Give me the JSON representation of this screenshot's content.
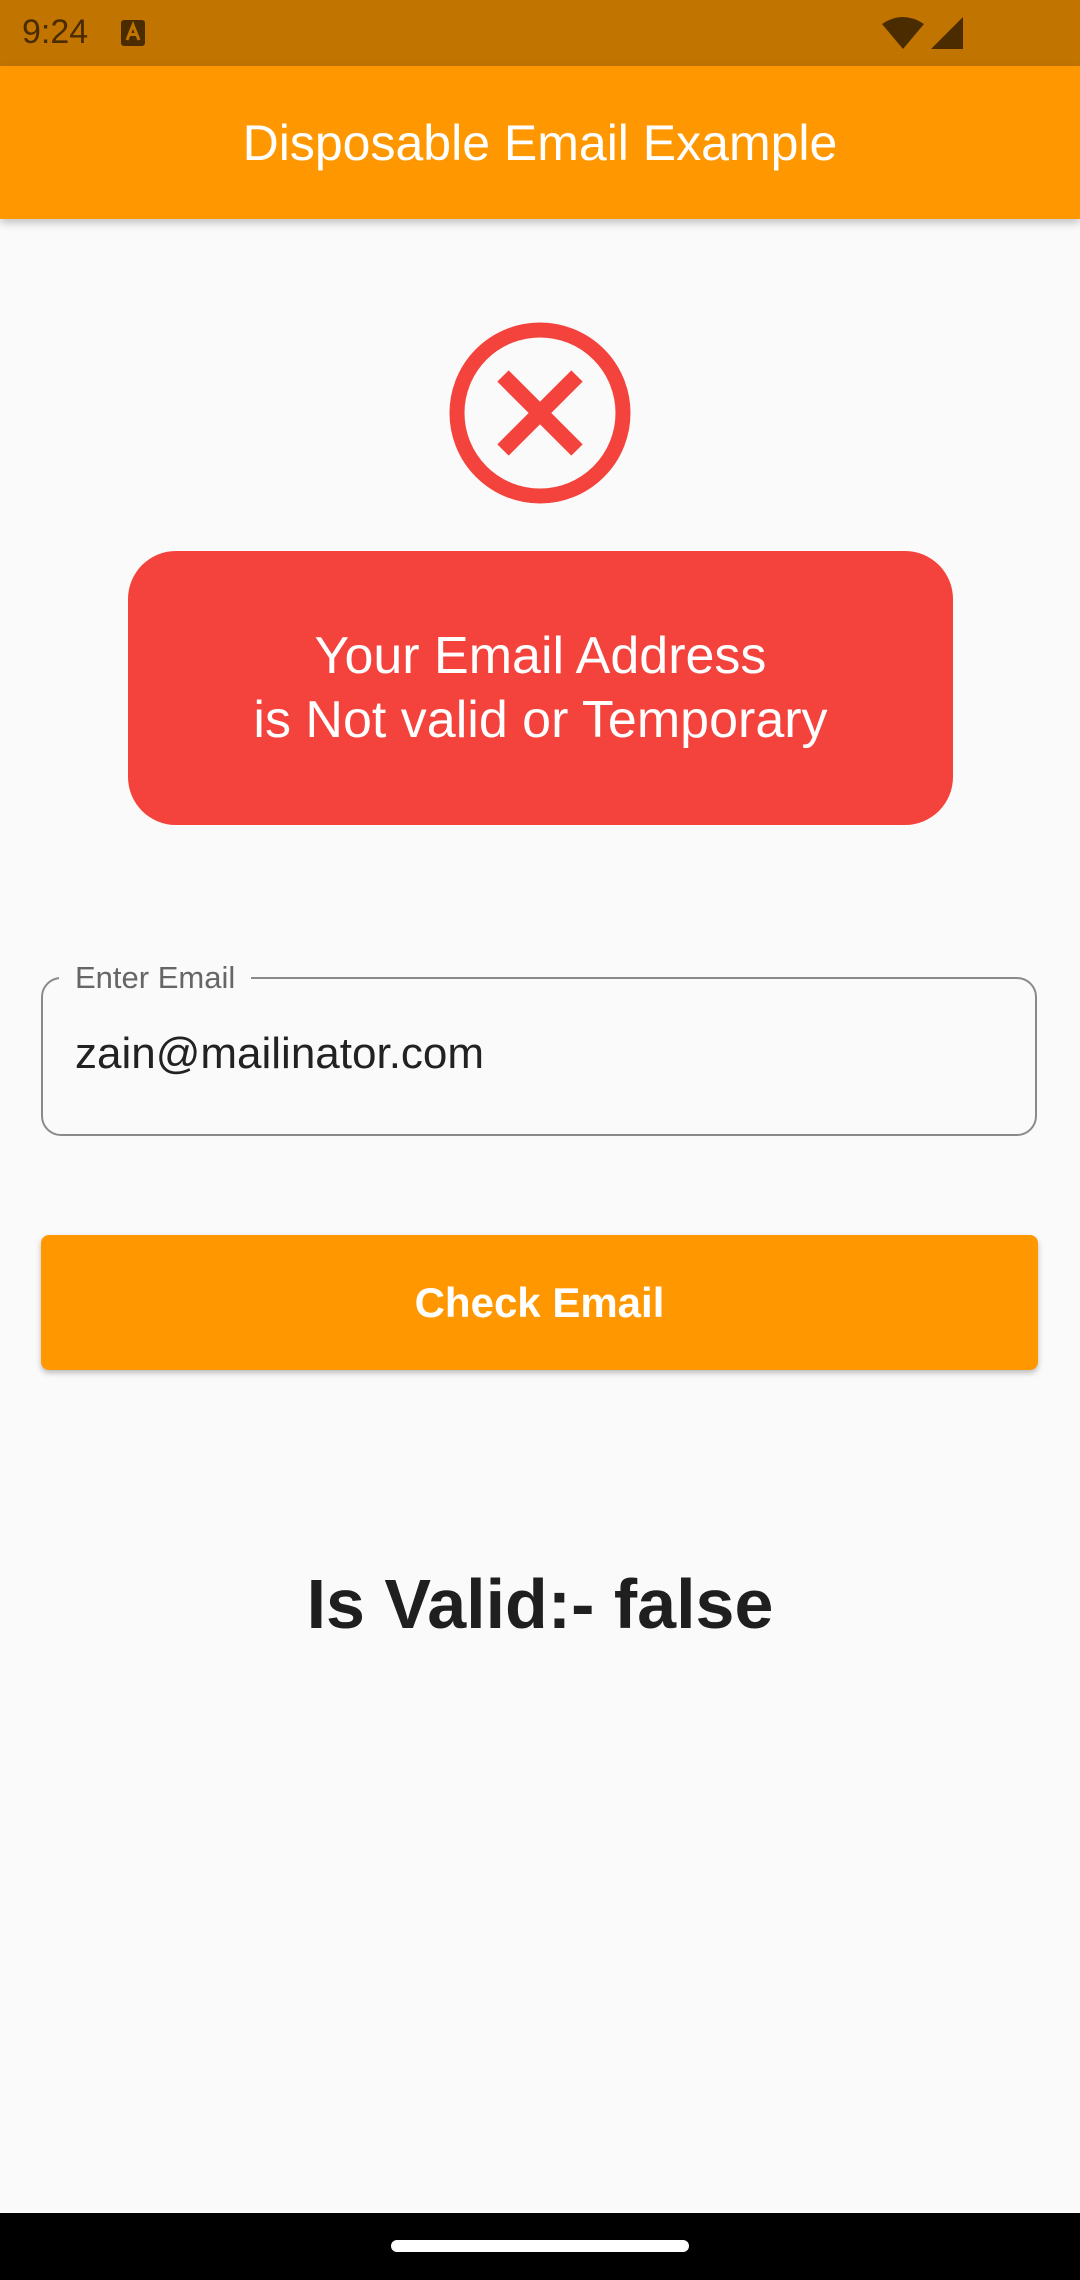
{
  "status_bar": {
    "time": "9:24",
    "notification_icon": "text-notification-icon",
    "wifi_icon": "wifi-icon",
    "signal_icon": "cell-signal-icon"
  },
  "app_bar": {
    "title": "Disposable Email Example",
    "color": "#ff9800"
  },
  "result": {
    "icon": "cancel-circle-icon",
    "icon_color": "#f4433c",
    "message_line1": "Your Email Address",
    "message_line2": "is Not valid or Temporary",
    "card_color": "#f4433c"
  },
  "email_field": {
    "label": "Enter Email",
    "value": "zain@mailinator.com"
  },
  "check_button": {
    "label": "Check Email"
  },
  "validity": {
    "text": "Is Valid:- false"
  }
}
